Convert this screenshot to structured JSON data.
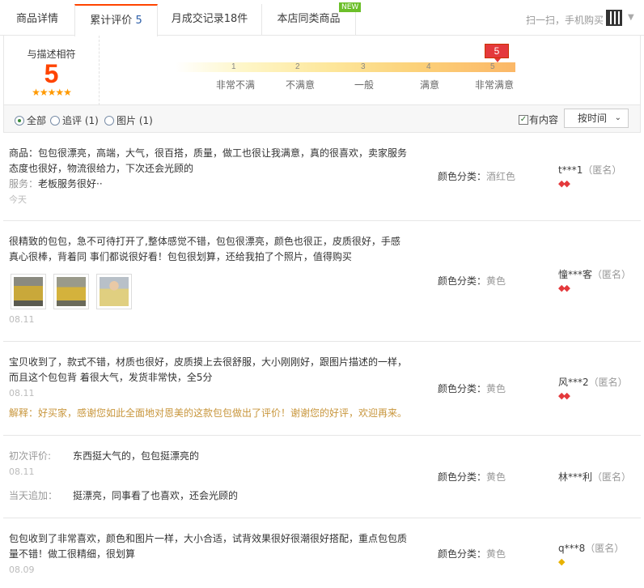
{
  "tabs": {
    "details": "商品详情",
    "reviews": "累计评价",
    "reviews_count": "5",
    "sales": "月成交记录18件",
    "similar": "本店同类商品",
    "new_badge": "NEW",
    "scan": "扫一扫，手机购买"
  },
  "summary": {
    "title": "与描述相符",
    "score": "5",
    "stars": "★★★★★",
    "flag": "5",
    "ticks": [
      "1",
      "2",
      "3",
      "4",
      "5"
    ],
    "labels": [
      "非常不满",
      "不满意",
      "一般",
      "满意",
      "非常满意"
    ]
  },
  "filter": {
    "all": "全部",
    "followup": "追评 (1)",
    "pictures": "图片 (1)",
    "has_content": "有内容",
    "has_content_check": "✓",
    "sort": "按时间",
    "sort_arrow": "⌄"
  },
  "reviews": [
    {
      "line1": "商品：包包很漂亮，高端，大气，很百搭，质量，做工也很让我满意，真的很喜欢，卖家服务",
      "line2": "态度也很好，物流很给力，下次还会光顾的",
      "service_label": "服务：",
      "service": "老板服务很好··",
      "date": "今天",
      "sku_label": "颜色分类：",
      "sku": "酒红色",
      "user": "t***1",
      "anon": "（匿名）",
      "level": "◆◆"
    },
    {
      "line1": "很精致的包包，急不可待打开了,整体感觉不错，包包很漂亮，颜色也很正，皮质很好，手感",
      "line2": "真心很棒，背着同 事们都说很好看！包包很划算，还给我拍了个照片，值得购买",
      "date": "08.11",
      "sku_label": "颜色分类：",
      "sku": "黄色",
      "user": "憧***客",
      "anon": "（匿名）",
      "level": "◆◆"
    },
    {
      "line1": "宝贝收到了，款式不错，材质也很好，皮质摸上去很舒服，大小刚刚好，跟图片描述的一样，",
      "line2": "而且这个包包背 着很大气，发货非常快，全5分",
      "date": "08.11",
      "reply": "解释：好买家，感谢您如此全面地对恩美的这款包包做出了评价！谢谢您的好评，欢迎再来。",
      "sku_label": "颜色分类：",
      "sku": "黄色",
      "user": "风***2",
      "anon": "（匿名）",
      "level": "◆◆"
    },
    {
      "first_label": "初次评价:",
      "first": "东西挺大气的，包包挺漂亮的",
      "date": "08.11",
      "append_label": "当天追加：",
      "append": "挺漂亮，同事看了也喜欢，还会光顾的",
      "sku_label": "颜色分类：",
      "sku": "黄色",
      "user": "林***利",
      "anon": "（匿名）"
    },
    {
      "line1": "包包收到了非常喜欢，颜色和图片一样，大小合适，试背效果很好很潮很好搭配，重点包包质",
      "line2": "量不错！做工很精细，很划算",
      "date": "08.09",
      "sku_label": "颜色分类：",
      "sku": "黄色",
      "user": "q***8",
      "anon": "（匿名）",
      "level": "◆"
    }
  ]
}
